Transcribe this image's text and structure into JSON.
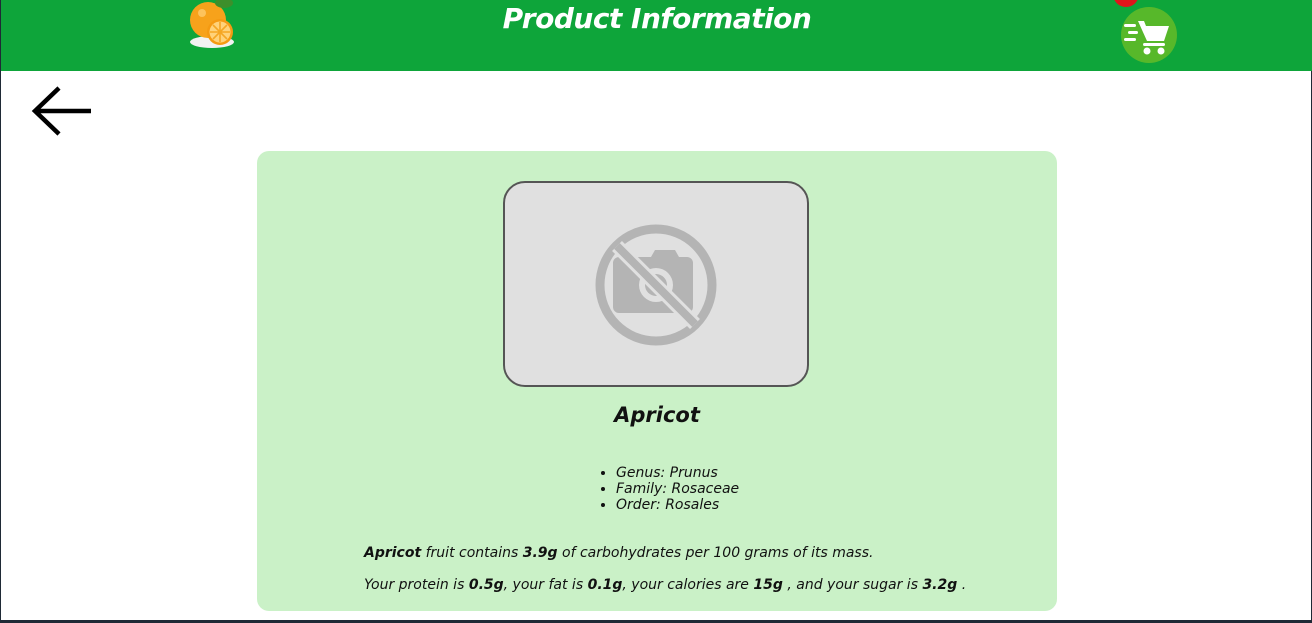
{
  "header": {
    "title": "Product Information",
    "logo_icon": "orange-fruit-icon",
    "cart_icon": "shopping-cart-icon",
    "accent_color": "#0ea53a"
  },
  "nav": {
    "back_icon": "arrow-left-icon"
  },
  "product": {
    "image_icon": "no-photo-icon",
    "name": "Apricot",
    "taxonomy": [
      "Genus: Prunus",
      "Family: Rosaceae",
      "Order: Rosales"
    ],
    "carbs_sentence": {
      "name": "Apricot",
      "text1": " fruit contains ",
      "carbohydrates": "3.9g",
      "text2": " of carbohydrates per 100 grams of its mass."
    },
    "nutrition_sentence": {
      "text1": "Your protein is ",
      "protein": "0.5g",
      "text2": ", your fat is ",
      "fat": "0.1g",
      "text3": ", your calories are ",
      "calories": "15g",
      "text4": " , and your sugar is ",
      "sugar": "3.2g",
      "text5": " ."
    },
    "card_color": "#caf1c7"
  }
}
